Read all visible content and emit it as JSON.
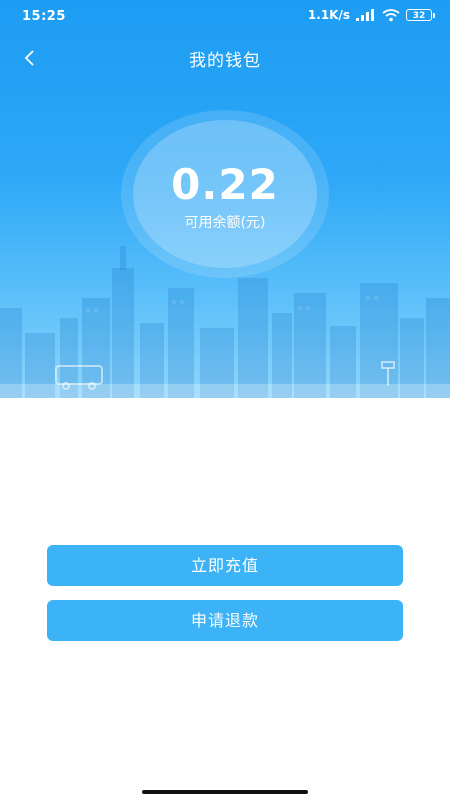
{
  "status_bar": {
    "time": "15:25",
    "network_speed": "1.1K/s",
    "battery_level": "32",
    "icons": [
      "signal-icon",
      "wifi-icon",
      "battery-icon"
    ]
  },
  "header": {
    "title": "我的钱包",
    "back_icon": "chevron-left-icon"
  },
  "balance": {
    "amount": "0.22",
    "label": "可用余额(元)"
  },
  "actions": {
    "recharge_label": "立即充值",
    "refund_label": "申请退款"
  },
  "colors": {
    "primary": "#1c9cf3",
    "button": "#3bb3f6",
    "text_on_primary": "#ffffff"
  }
}
